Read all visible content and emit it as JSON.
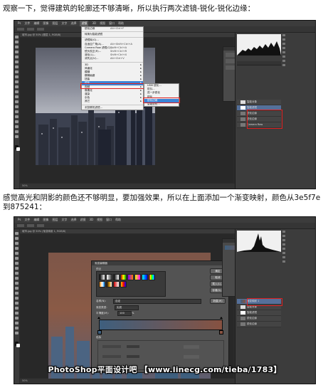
{
  "captions": {
    "first": "观察一下，觉得建筑的轮廓还不够清晰，所以执行两次滤镜-锐化-锐化边缘：",
    "second": "感觉高光和阴影的颜色还不够明显，要加强效果，所以在上面添加一个渐变映射，颜色从3e5f7e到875241："
  },
  "screenshot1": {
    "filter_menu": [
      {
        "label": "锐化边缘",
        "shortcut": "Alt+Ctrl+F"
      },
      {
        "label": "转换为智能滤镜",
        "shortcut": ""
      },
      {
        "label": "滤镜库(G)...",
        "shortcut": ""
      },
      {
        "label": "自适应广角(A)...",
        "shortcut": "Alt+Shift+Ctrl+A"
      },
      {
        "label": "Camera Raw 滤镜(C)...",
        "shortcut": "Shift+Ctrl+A"
      },
      {
        "label": "镜头校正(R)...",
        "shortcut": "Shift+Ctrl+R"
      },
      {
        "label": "液化(L)...",
        "shortcut": "Shift+Ctrl+X"
      },
      {
        "label": "消失点(V)...",
        "shortcut": "Alt+Ctrl+V"
      },
      {
        "label": "3D",
        "shortcut": "",
        "sub": true
      },
      {
        "label": "风格化",
        "shortcut": "",
        "sub": true
      },
      {
        "label": "模糊",
        "shortcut": "",
        "sub": true
      },
      {
        "label": "模糊画廊",
        "shortcut": "",
        "sub": true
      },
      {
        "label": "扭曲",
        "shortcut": "",
        "sub": true
      },
      {
        "label": "锐化",
        "shortcut": "",
        "sub": true,
        "highlight": true
      },
      {
        "label": "视频",
        "shortcut": "",
        "sub": true
      },
      {
        "label": "像素化",
        "shortcut": "",
        "sub": true
      },
      {
        "label": "渲染",
        "shortcut": "",
        "sub": true
      },
      {
        "label": "杂色",
        "shortcut": "",
        "sub": true
      },
      {
        "label": "其它",
        "shortcut": "",
        "sub": true
      },
      {
        "label": "浏览联机滤镜...",
        "shortcut": ""
      }
    ],
    "sharpen_submenu": [
      "USM 锐化...",
      "防抖...",
      "进一步锐化",
      "锐化",
      "锐化边缘",
      "智能锐化..."
    ]
  },
  "screenshot2": {
    "dialog_title": "渐变编辑器",
    "gradient_name_label": "名称(N):",
    "gradient_name_value": "自定",
    "buttons": [
      "确定",
      "取消",
      "载入(L)...",
      "存储(S)...",
      "新建(W)"
    ],
    "gradient_type_label": "渐变类型:",
    "gradient_type_value": "实底",
    "smoothness_label": "平滑度(M):",
    "smoothness_value": "100",
    "smoothness_unit": "%",
    "stops_label": "色标",
    "color_from": "#3e5f7e",
    "color_to": "#875241"
  },
  "watermark": "PhotoShop平面设计吧 【www.linecg.com/tieba/1783】"
}
